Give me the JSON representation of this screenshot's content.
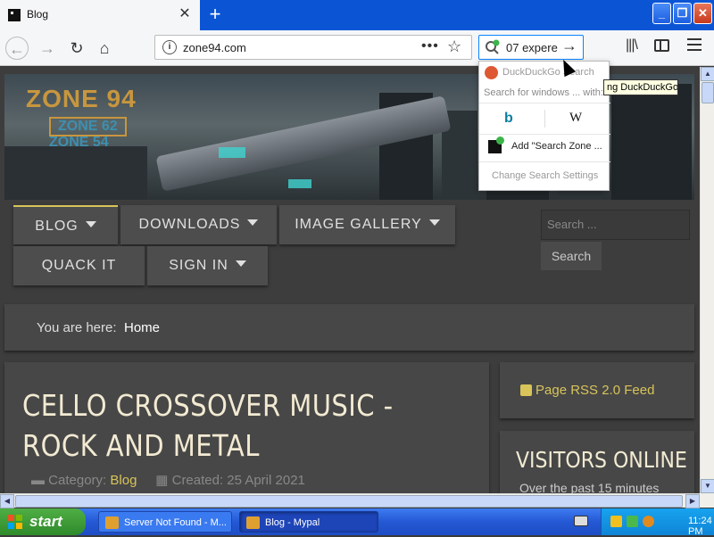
{
  "tab": {
    "title": "Blog",
    "close": "✕",
    "new_tab": "+"
  },
  "window": {
    "minimize": "_",
    "maximize": "❐",
    "close": "✕"
  },
  "nav": {
    "back": "←",
    "forward": "→",
    "reload": "↻",
    "home": "⌂",
    "url": "zone94.com",
    "page_actions": "•••",
    "bookmark": "☆",
    "search_value": "07 expere",
    "search_go": "→"
  },
  "banner": {
    "logo_main": "ZONE 94",
    "logo_sub1": "ZONE 62",
    "logo_sub2": "ZONE 54"
  },
  "menu": {
    "items": [
      {
        "label": "BLOG",
        "active": true
      },
      {
        "label": "DOWNLOADS"
      },
      {
        "label": "IMAGE GALLERY"
      },
      {
        "label": "QUACK IT"
      },
      {
        "label": "SIGN IN"
      }
    ],
    "search_placeholder": "Search ...",
    "search_button": "Search"
  },
  "breadcrumb": {
    "label": "You are here:",
    "current": "Home"
  },
  "article": {
    "title": "CELLO CROSSOVER MUSIC - ROCK AND METAL",
    "category_label": "Category:",
    "category": "Blog",
    "created": "Created: 25 April 2021"
  },
  "sidebar": {
    "rss": "Page RSS 2.0 Feed",
    "visitors_title": "VISITORS ONLINE",
    "visitors_sub": "Over the past 15 minutes"
  },
  "search_popup": {
    "engine": "DuckDuckGo Search",
    "search_for": "Search for windows ... with:",
    "wiki": "W",
    "add": "Add \"Search Zone ...",
    "settings": "Change Search Settings",
    "tooltip": "ng DuckDuckGo"
  },
  "taskbar": {
    "start": "start",
    "tasks": [
      {
        "label": "Server Not Found - M..."
      },
      {
        "label": "Blog - Mypal"
      }
    ],
    "clock": "11:24 PM"
  },
  "colors": {
    "accent": "#d8c45a",
    "title_text": "#f2ead2",
    "xp_blue": "#2458d4"
  }
}
